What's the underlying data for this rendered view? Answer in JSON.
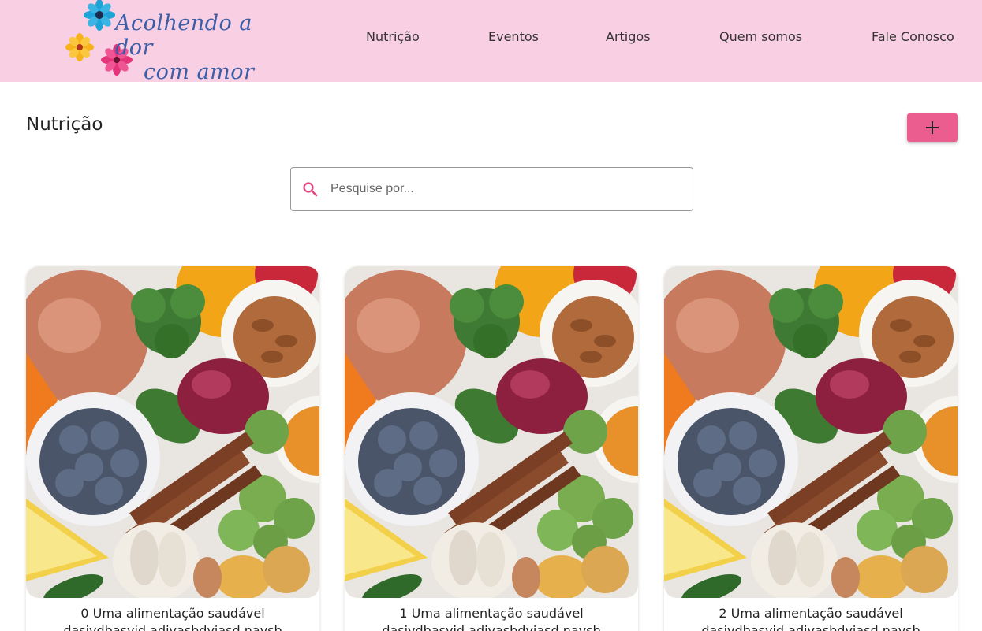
{
  "header": {
    "logo_line1": "Acolhendo a dor",
    "logo_line2": "com amor",
    "nav": [
      "Nutrição",
      "Eventos",
      "Artigos",
      "Quem somos",
      "Fale Conosco"
    ]
  },
  "page": {
    "title": "Nutrição",
    "add_label": "+"
  },
  "search": {
    "placeholder": "Pesquise por...",
    "value": ""
  },
  "cards": [
    {
      "title": "0 Uma alimentação saudável",
      "description": "dasjvdbasvjd adjvasbdvjasd navsb"
    },
    {
      "title": "1 Uma alimentação saudável",
      "description": "dasjvdbasvjd adjvasbdvjasd navsb"
    },
    {
      "title": "2 Uma alimentação saudável",
      "description": "dasjvdbasvjd adjvasbdvjasd navsb"
    }
  ],
  "colors": {
    "header_bg": "#f8cfe3",
    "accent": "#ec5d8f",
    "logo_text": "#3b5ea8"
  }
}
